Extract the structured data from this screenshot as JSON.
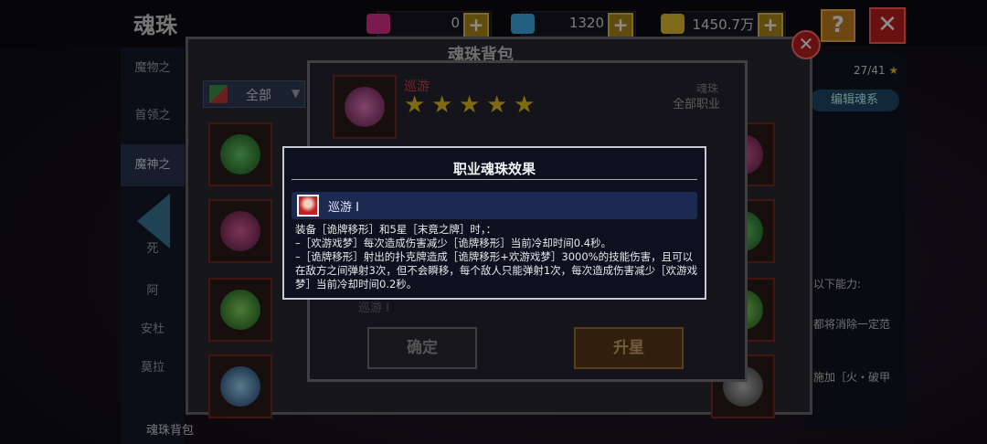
{
  "header": {
    "title": "魂珠",
    "currencies": [
      {
        "icon": "heart-gem-icon",
        "value": "0",
        "color": "#e0308a"
      },
      {
        "icon": "blue-diamond-icon",
        "value": "1320",
        "color": "#40b0e8"
      },
      {
        "icon": "gold-coin-icon",
        "value": "1450.7万",
        "color": "#e8c030"
      }
    ],
    "plus": "+",
    "help": "?",
    "close": "✕"
  },
  "sidenav": {
    "items": [
      "魔物之",
      "首领之",
      "魔神之",
      "死",
      "阿",
      "安杜",
      "莫拉"
    ],
    "bag_label": "魂珠背包"
  },
  "right_panel": {
    "count": "27/41",
    "edit_button": "编辑魂系",
    "lines": [
      "以下能力:",
      "都将消除一定范",
      "施加［火・破甲"
    ]
  },
  "bag": {
    "title": "魂珠背包",
    "close": "✕",
    "filter_label": "全部"
  },
  "detail": {
    "name": "巡游",
    "type": "魂珠",
    "class": "全部职业",
    "stars": 5,
    "ghost_name": "巡游 I",
    "confirm_button": "确定",
    "upgrade_button": "升星"
  },
  "modal": {
    "title": "职业魂珠效果",
    "head_name": "巡游 I",
    "body_lines": [
      "装备［诡牌移形］和5星［末竟之牌］时，：",
      "–［欢游戏梦］每次造成伤害减少［诡牌移形］当前冷却时间0.4秒。",
      "–［诡牌移形］射出的扑克牌造成［诡牌移形+欢游戏梦］3000%的技能伤害，且可以在敌方之间弹射3次，但不会瞬移，每个敌人只能弹射1次，每次造成伤害减少［欢游戏梦］当前冷却时间0.2秒。"
    ]
  },
  "colors": {
    "accent_red": "#e04040",
    "gold": "#e8c020"
  }
}
